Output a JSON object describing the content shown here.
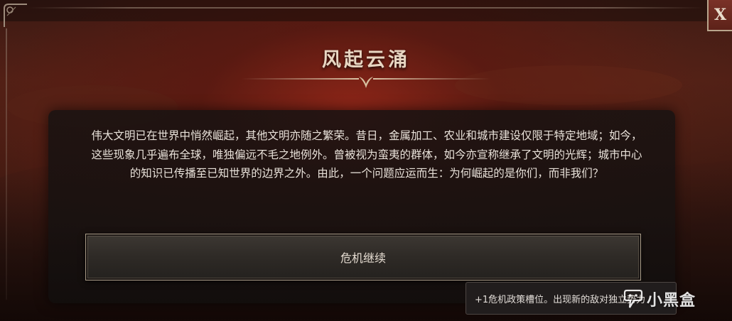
{
  "dialog": {
    "title": "风起云涌",
    "body": "伟大文明已在世界中悄然崛起，其他文明亦随之繁荣。昔日，金属加工、农业和城市建设仅限于特定地域；如今，这些现象几乎遍布全球，唯独偏远不毛之地例外。曾被视为蛮夷的群体，如今亦宣称继承了文明的光辉；城市中心的知识已传播至已知世界的边界之外。由此，一个问题应运而生：为何崛起的是你们，而非我们？",
    "action_label": "危机继续",
    "tooltip": "+1危机政策槽位。出现新的敌对独立势力",
    "close_label": "X"
  },
  "watermark": {
    "text": "小黑盒",
    "icon": "heybox-logo-icon"
  },
  "colors": {
    "title": "#e8d6c2",
    "body_text": "#e9e2da",
    "panel": "#1a1412",
    "button_border": "#a89a86",
    "close_bg": "#6b2a20"
  }
}
